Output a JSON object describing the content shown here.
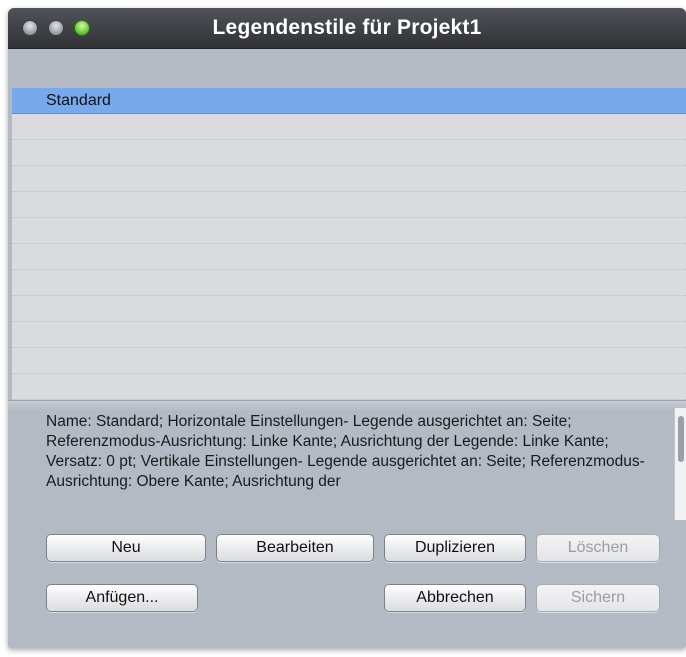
{
  "window": {
    "title": "Legendenstile für Projekt1"
  },
  "styles_list": {
    "items": [
      {
        "label": "Standard",
        "selected": true
      }
    ]
  },
  "description": "Name: Standard; Horizontale Einstellungen- Legende ausgerichtet an: Seite; Referenzmodus-Ausrichtung: Linke Kante; Ausrichtung der Legende: Linke Kante; Versatz: 0 pt; Vertikale Einstellungen- Legende ausgerichtet an: Seite; Referenzmodus-Ausrichtung: Obere Kante; Ausrichtung der",
  "buttons": {
    "new": {
      "label": "Neu",
      "enabled": true
    },
    "edit": {
      "label": "Bearbeiten",
      "enabled": true
    },
    "duplicate": {
      "label": "Duplizieren",
      "enabled": true
    },
    "delete": {
      "label": "Löschen",
      "enabled": false
    },
    "append": {
      "label": "Anfügen...",
      "enabled": true
    },
    "cancel": {
      "label": "Abbrechen",
      "enabled": true
    },
    "save": {
      "label": "Sichern",
      "enabled": false
    }
  },
  "colors": {
    "selection": "#78a9ec",
    "window_background": "#b4bac4",
    "titlebar": "#3a3c40"
  }
}
